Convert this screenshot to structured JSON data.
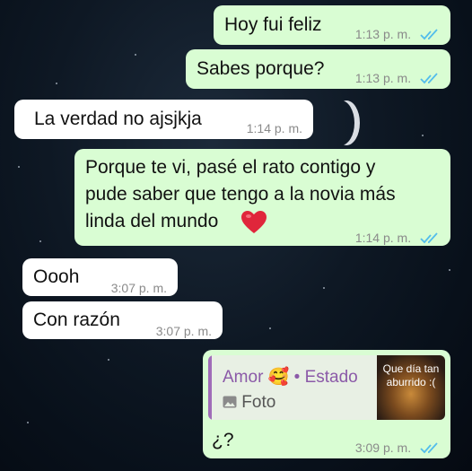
{
  "messages": [
    {
      "text": "Hoy fui feliz",
      "time": "1:13 p. m.",
      "dir": "out"
    },
    {
      "text": "Sabes porque?",
      "time": "1:13 p. m.",
      "dir": "out"
    },
    {
      "text": "La verdad no ajsjkja",
      "time": "1:14 p. m.",
      "dir": "in"
    },
    {
      "text_line1": "Porque te vi, pasé el rato contigo y",
      "text_line2": "pude saber que tengo a la novia más",
      "text_line3": "linda del mundo",
      "emoji": "❤️",
      "time": "1:14 p. m.",
      "dir": "out"
    },
    {
      "text": "Oooh",
      "time": "3:07 p. m.",
      "dir": "in"
    },
    {
      "text": "Con razón",
      "time": "3:07 p. m.",
      "dir": "in"
    },
    {
      "reply": {
        "name": "Amor",
        "emoji": "🥰",
        "separator": "•",
        "context": "Estado",
        "media_label": "Foto",
        "thumb_text": "Que día tan aburrido :("
      },
      "text": "¿?",
      "time": "3:09 p. m.",
      "dir": "out"
    }
  ],
  "colors": {
    "outgoing": "#d9fdd3",
    "incoming": "#ffffff",
    "read_ticks": "#53bdeb",
    "reply_accent": "#a06cb8"
  },
  "icons": {
    "read": "double-check-icon",
    "photo": "photo-icon"
  }
}
